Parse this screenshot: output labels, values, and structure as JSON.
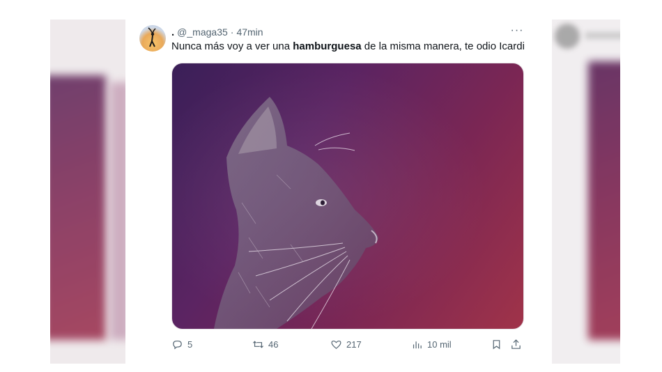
{
  "tweet": {
    "name": ".",
    "handle": "@_maga35",
    "separator": "·",
    "time": "47min",
    "more": "···",
    "text_before": "Nunca más voy a ver una ",
    "text_bold": "hamburguesa",
    "text_after": " de la misma manera, te odio Icardi",
    "media_icon": "cat-photo",
    "actions": {
      "replies": "5",
      "retweets": "46",
      "likes": "217",
      "views": "10 mil"
    }
  },
  "icons": {
    "reply": "reply-icon",
    "retweet": "retweet-icon",
    "like": "heart-icon",
    "views": "views-icon",
    "bookmark": "bookmark-icon",
    "share": "share-icon"
  },
  "colors": {
    "text": "#0f1419",
    "muted": "#536471",
    "media_gradient_start": "#3a1f58",
    "media_gradient_end": "#a03349"
  }
}
